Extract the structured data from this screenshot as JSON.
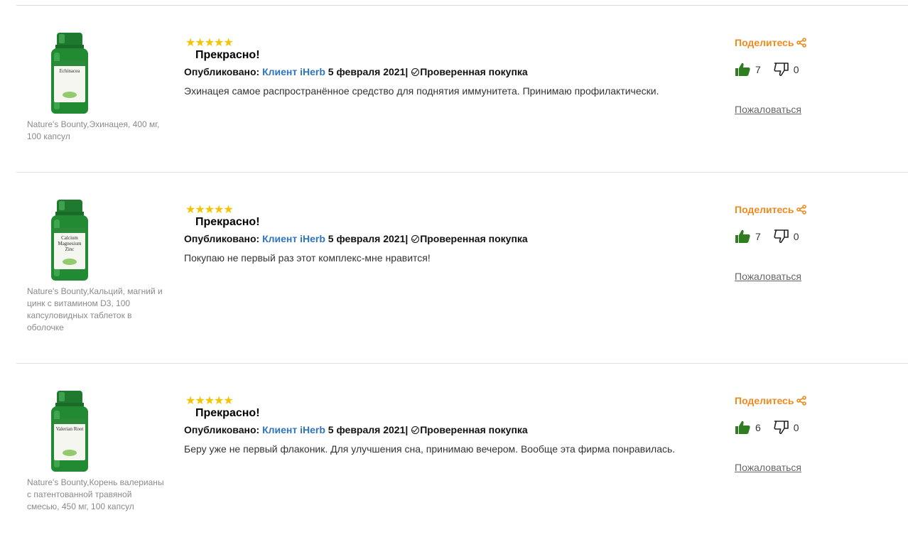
{
  "reviews": [
    {
      "product": {
        "name": "Nature's Bounty,Эхинацея, 400 мг, 100 капсул",
        "bottle_label": "Echinacea"
      },
      "stars": "★★★★★",
      "title": "Прекрасно!",
      "published_label": "Опубликовано: ",
      "author": "Клиент iHerb",
      "date": " 5 февраля 2021",
      "separator": "|",
      "verified": "Проверенная покупка",
      "text": "Эхинацея самое распространённое средство для поднятия иммунитета. Принимаю профилактически.",
      "share_label": "Поделитесь",
      "helpful_count": "7",
      "unhelpful_count": "0",
      "report_label": "Пожаловаться"
    },
    {
      "product": {
        "name": "Nature's Bounty,Кальций, магний и цинк с витамином D3, 100 капсуловидных таблеток в оболочке",
        "bottle_label": "Calcium Magnesium Zinc"
      },
      "stars": "★★★★★",
      "title": "Прекрасно!",
      "published_label": "Опубликовано: ",
      "author": "Клиент iHerb",
      "date": " 5 февраля 2021",
      "separator": "|",
      "verified": "Проверенная покупка",
      "text": "Покупаю не первый раз этот комплекс-мне нравится!",
      "share_label": "Поделитесь",
      "helpful_count": "7",
      "unhelpful_count": "0",
      "report_label": "Пожаловаться"
    },
    {
      "product": {
        "name": "Nature's Bounty,Корень валерианы с патентованной травяной смесью, 450 мг, 100 капсул",
        "bottle_label": "Valerian Root"
      },
      "stars": "★★★★★",
      "title": "Прекрасно!",
      "published_label": "Опубликовано: ",
      "author": "Клиент iHerb",
      "date": " 5 февраля 2021",
      "separator": "|",
      "verified": "Проверенная покупка",
      "text": "Беру уже не первый флаконик. Для улучшения сна, принимаю вечером. Вообще эта фирма понравилась.",
      "share_label": "Поделитесь",
      "helpful_count": "6",
      "unhelpful_count": "0",
      "report_label": "Пожаловаться"
    }
  ],
  "colors": {
    "star": "#f5c300",
    "author_link": "#2f74c0",
    "share": "#f08a1c",
    "thumb_up": "#2e7d1f",
    "bottle_green": "#238a34"
  },
  "icons": [
    "star-icon",
    "verified-check-icon",
    "share-icon",
    "thumbs-up-icon",
    "thumbs-down-icon"
  ]
}
